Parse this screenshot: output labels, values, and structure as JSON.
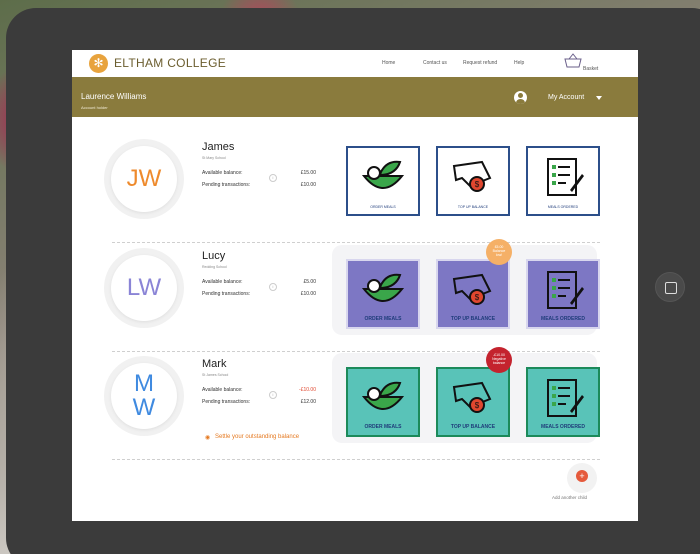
{
  "header": {
    "brand": "ELTHAM COLLEGE",
    "logo_icon": "snowflake-emblem-icon",
    "nav": [
      "Home",
      "Contact us",
      "Request refund",
      "Help"
    ],
    "basket_label": "Basket"
  },
  "account": {
    "holder_name": "Laurence Williams",
    "holder_role": "Account holder",
    "menu_label": "My Account"
  },
  "labels": {
    "available": "Available balance:",
    "pending": "Pending transactions:",
    "order_meals": "ORDER MEALS",
    "top_up": "TOP UP BALANCE",
    "meals_ordered": "MEALS ORDERED"
  },
  "children": [
    {
      "initials": "JW",
      "name": "James",
      "school": "St Mary School",
      "available": "£15.00",
      "pending": "£10.00",
      "initials_color": "#ee8a2c",
      "tile_color": "#ffffff",
      "tile_border": "#2c4f8a"
    },
    {
      "initials": "LW",
      "name": "Lucy",
      "school": "Redding School",
      "available": "£5.00",
      "pending": "£10.00",
      "initials_color": "#8a84d6",
      "tile_color": "#7d77c4",
      "tile_border": "#d8d6ee",
      "badge": {
        "line1": "£5.00",
        "line2": "Balance",
        "line3": "low!",
        "color": "#f5b067"
      }
    },
    {
      "initials": "M\nW",
      "name": "Mark",
      "school": "St James School",
      "available": "-£10.00",
      "pending": "£12.00",
      "initials_color": "#3f8ae0",
      "tile_color": "#59c3b8",
      "tile_border": "#1c8a5a",
      "settle": "Settle your outstanding balance",
      "badge": {
        "line1": "-£10.00",
        "line2": "Negative",
        "line3": "balance",
        "color": "#c4232e"
      }
    }
  ],
  "add_child": "Add another child"
}
